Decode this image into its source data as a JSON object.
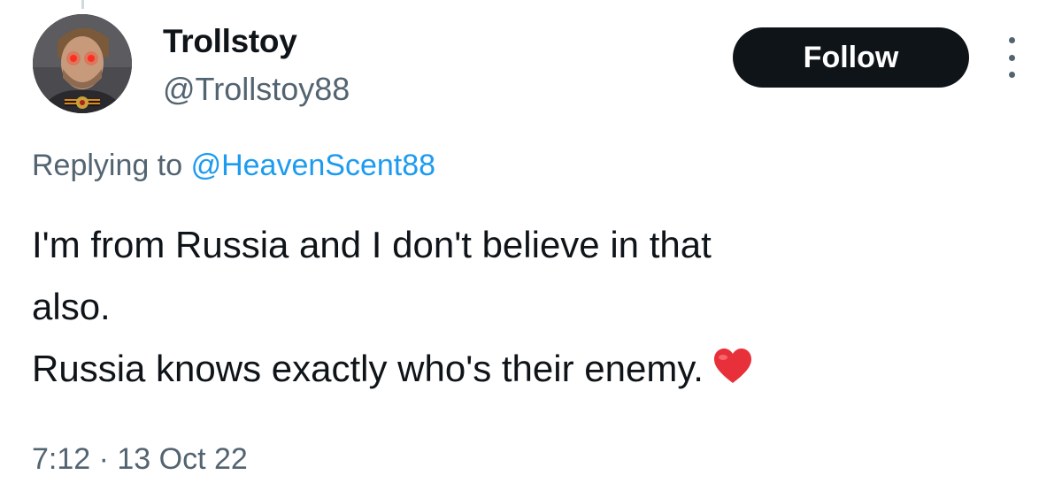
{
  "author": {
    "display_name": "Trollstoy",
    "handle": "@Trollstoy88",
    "avatar": "avatar-photo"
  },
  "follow_button": {
    "label": "Follow"
  },
  "more_button": {
    "icon": "more-vertical-icon"
  },
  "reply_context": {
    "prefix": "Replying to",
    "mention": "@HeavenScent88"
  },
  "tweet": {
    "lines": [
      "I'm from Russia and I don't believe in that",
      "also.",
      "Russia knows exactly who's their enemy."
    ],
    "emoji": "red-heart-icon"
  },
  "meta": {
    "timestamp": "7:12 · 13 Oct 22"
  },
  "colors": {
    "text_primary": "#0f1419",
    "text_secondary": "#536471",
    "link": "#1d9bf0",
    "button_bg": "#0f1419",
    "button_text": "#ffffff",
    "heart": "#e8303b"
  }
}
